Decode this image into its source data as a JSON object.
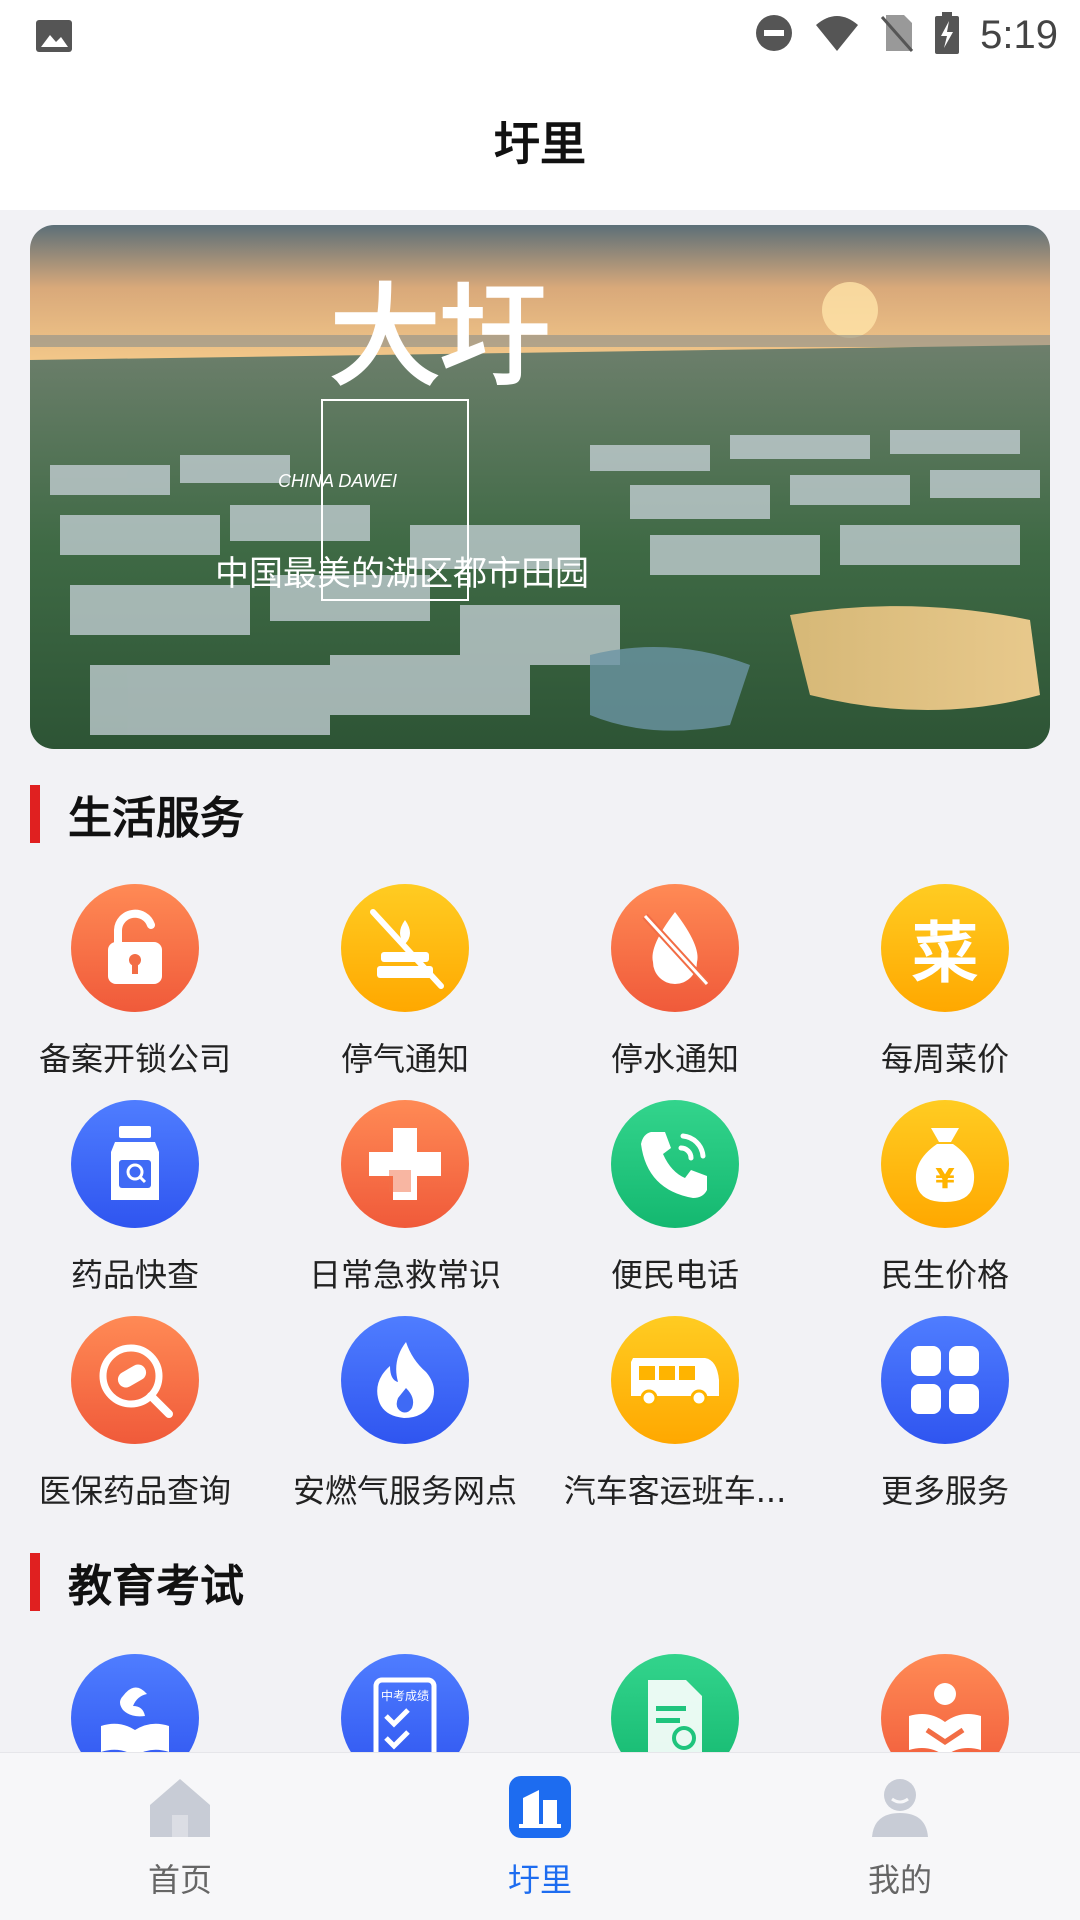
{
  "status_bar": {
    "time": "5:19"
  },
  "header": {
    "title": "圩里"
  },
  "banner": {
    "headline": "大圩",
    "subtitle_en": "CHINA DAWEI",
    "slogan": "中国最美的湖区都市田园"
  },
  "sections": [
    {
      "title": "生活服务",
      "items": [
        {
          "label": "备案开锁公司",
          "icon": "unlock-icon",
          "color": "#f26d45"
        },
        {
          "label": "停气通知",
          "icon": "gas-off-icon",
          "color": "#ffb400"
        },
        {
          "label": "停水通知",
          "icon": "water-off-icon",
          "color": "#f26d45"
        },
        {
          "label": "每周菜价",
          "icon": "vegetable-price-icon",
          "icon_text": "菜",
          "color": "#ffb400"
        },
        {
          "label": "药品快查",
          "icon": "medicine-bottle-icon",
          "color": "#3f6af5"
        },
        {
          "label": "日常急救常识",
          "icon": "first-aid-icon",
          "color": "#f26d45"
        },
        {
          "label": "便民电话",
          "icon": "phone-icon",
          "color": "#1fc47d"
        },
        {
          "label": "民生价格",
          "icon": "money-bag-icon",
          "icon_text": "¥",
          "color": "#ffb400"
        },
        {
          "label": "医保药品查询",
          "icon": "pill-search-icon",
          "color": "#f26d45"
        },
        {
          "label": "安燃气服务网点",
          "icon": "flame-icon",
          "color": "#3f6af5"
        },
        {
          "label": "汽车客运班车...",
          "icon": "bus-icon",
          "color": "#ffb400"
        },
        {
          "label": "更多服务",
          "icon": "more-grid-icon",
          "color": "#3f6af5"
        }
      ]
    },
    {
      "title": "教育考试",
      "items": [
        {
          "label": "",
          "icon": "education-book-icon",
          "color": "#3f6af5"
        },
        {
          "label": "",
          "icon": "exam-score-icon",
          "icon_text": "中考成绩",
          "color": "#3f6af5"
        },
        {
          "label": "",
          "icon": "document-search-icon",
          "color": "#1fc47d"
        },
        {
          "label": "",
          "icon": "reading-icon",
          "color": "#f26d45"
        }
      ]
    }
  ],
  "tabbar": {
    "tabs": [
      {
        "label": "首页",
        "icon": "home-icon"
      },
      {
        "label": "圩里",
        "icon": "building-icon",
        "active": true
      },
      {
        "label": "我的",
        "icon": "user-icon"
      }
    ],
    "active_color": "#1d6cf0"
  }
}
